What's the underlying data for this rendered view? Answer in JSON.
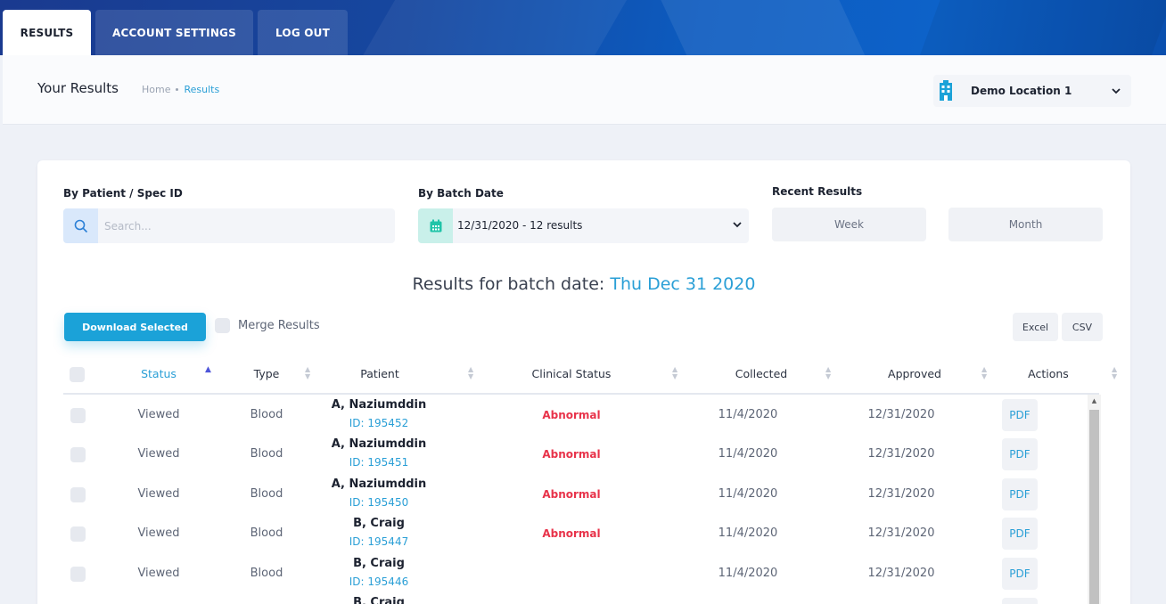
{
  "tabs": [
    {
      "label": "RESULTS"
    },
    {
      "label": "ACCOUNT SETTINGS"
    },
    {
      "label": "LOG OUT"
    }
  ],
  "header": {
    "title": "Your Results",
    "breadcrumb": [
      "Home",
      "Results"
    ],
    "location": "Demo Location 1"
  },
  "filters": {
    "patient_label": "By Patient / Spec ID",
    "search_placeholder": "Search...",
    "batch_label": "By Batch Date",
    "batch_value": "12/31/2020 - 12 results",
    "recent_label": "Recent Results",
    "week": "Week",
    "month": "Month"
  },
  "results_heading": {
    "prefix": "Results for batch date:",
    "date": "Thu Dec 31 2020"
  },
  "toolbar": {
    "download": "Download Selected",
    "merge": "Merge Results",
    "excel": "Excel",
    "csv": "CSV"
  },
  "columns": [
    "Status",
    "Type",
    "Patient",
    "Clinical Status",
    "Collected",
    "Approved",
    "Actions"
  ],
  "rows": [
    {
      "status": "Viewed",
      "type": "Blood",
      "patient": "A, Naziumddin",
      "id": "ID: 195452",
      "clinical": "Abnormal",
      "collected": "11/4/2020",
      "approved": "12/31/2020",
      "action": "PDF"
    },
    {
      "status": "Viewed",
      "type": "Blood",
      "patient": "A, Naziumddin",
      "id": "ID: 195451",
      "clinical": "Abnormal",
      "collected": "11/4/2020",
      "approved": "12/31/2020",
      "action": "PDF"
    },
    {
      "status": "Viewed",
      "type": "Blood",
      "patient": "A, Naziumddin",
      "id": "ID: 195450",
      "clinical": "Abnormal",
      "collected": "11/4/2020",
      "approved": "12/31/2020",
      "action": "PDF"
    },
    {
      "status": "Viewed",
      "type": "Blood",
      "patient": "B, Craig",
      "id": "ID: 195447",
      "clinical": "Abnormal",
      "collected": "11/4/2020",
      "approved": "12/31/2020",
      "action": "PDF"
    },
    {
      "status": "Viewed",
      "type": "Blood",
      "patient": "B, Craig",
      "id": "ID: 195446",
      "clinical": "",
      "collected": "11/4/2020",
      "approved": "12/31/2020",
      "action": "PDF"
    },
    {
      "status": "",
      "type": "",
      "patient": "B, Craig",
      "id": "",
      "clinical": "",
      "collected": "",
      "approved": "",
      "action": ""
    }
  ],
  "colors": {
    "accent": "#2a9fd6",
    "primary_button": "#1ba2d8",
    "abnormal": "#e8334a",
    "banner": "#0c5bbf"
  },
  "icons": {
    "location": "building-icon",
    "search": "search-icon",
    "batch": "calendar-icon"
  }
}
